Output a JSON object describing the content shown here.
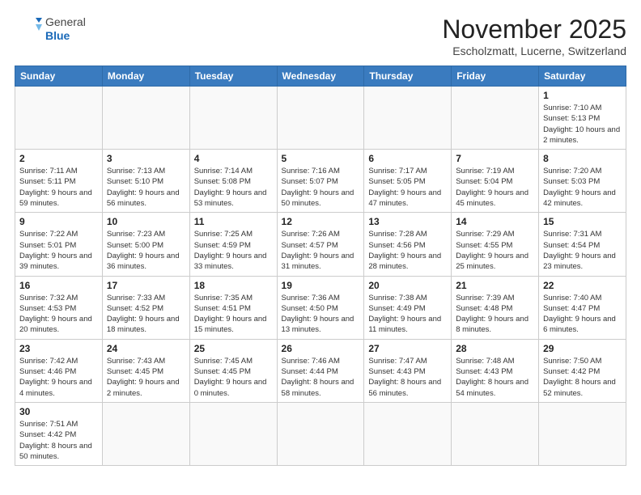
{
  "header": {
    "logo_general": "General",
    "logo_blue": "Blue",
    "month_title": "November 2025",
    "location": "Escholzmatt, Lucerne, Switzerland"
  },
  "weekdays": [
    "Sunday",
    "Monday",
    "Tuesday",
    "Wednesday",
    "Thursday",
    "Friday",
    "Saturday"
  ],
  "weeks": [
    [
      {
        "day": "",
        "info": ""
      },
      {
        "day": "",
        "info": ""
      },
      {
        "day": "",
        "info": ""
      },
      {
        "day": "",
        "info": ""
      },
      {
        "day": "",
        "info": ""
      },
      {
        "day": "",
        "info": ""
      },
      {
        "day": "1",
        "info": "Sunrise: 7:10 AM\nSunset: 5:13 PM\nDaylight: 10 hours\nand 2 minutes."
      }
    ],
    [
      {
        "day": "2",
        "info": "Sunrise: 7:11 AM\nSunset: 5:11 PM\nDaylight: 9 hours\nand 59 minutes."
      },
      {
        "day": "3",
        "info": "Sunrise: 7:13 AM\nSunset: 5:10 PM\nDaylight: 9 hours\nand 56 minutes."
      },
      {
        "day": "4",
        "info": "Sunrise: 7:14 AM\nSunset: 5:08 PM\nDaylight: 9 hours\nand 53 minutes."
      },
      {
        "day": "5",
        "info": "Sunrise: 7:16 AM\nSunset: 5:07 PM\nDaylight: 9 hours\nand 50 minutes."
      },
      {
        "day": "6",
        "info": "Sunrise: 7:17 AM\nSunset: 5:05 PM\nDaylight: 9 hours\nand 47 minutes."
      },
      {
        "day": "7",
        "info": "Sunrise: 7:19 AM\nSunset: 5:04 PM\nDaylight: 9 hours\nand 45 minutes."
      },
      {
        "day": "8",
        "info": "Sunrise: 7:20 AM\nSunset: 5:03 PM\nDaylight: 9 hours\nand 42 minutes."
      }
    ],
    [
      {
        "day": "9",
        "info": "Sunrise: 7:22 AM\nSunset: 5:01 PM\nDaylight: 9 hours\nand 39 minutes."
      },
      {
        "day": "10",
        "info": "Sunrise: 7:23 AM\nSunset: 5:00 PM\nDaylight: 9 hours\nand 36 minutes."
      },
      {
        "day": "11",
        "info": "Sunrise: 7:25 AM\nSunset: 4:59 PM\nDaylight: 9 hours\nand 33 minutes."
      },
      {
        "day": "12",
        "info": "Sunrise: 7:26 AM\nSunset: 4:57 PM\nDaylight: 9 hours\nand 31 minutes."
      },
      {
        "day": "13",
        "info": "Sunrise: 7:28 AM\nSunset: 4:56 PM\nDaylight: 9 hours\nand 28 minutes."
      },
      {
        "day": "14",
        "info": "Sunrise: 7:29 AM\nSunset: 4:55 PM\nDaylight: 9 hours\nand 25 minutes."
      },
      {
        "day": "15",
        "info": "Sunrise: 7:31 AM\nSunset: 4:54 PM\nDaylight: 9 hours\nand 23 minutes."
      }
    ],
    [
      {
        "day": "16",
        "info": "Sunrise: 7:32 AM\nSunset: 4:53 PM\nDaylight: 9 hours\nand 20 minutes."
      },
      {
        "day": "17",
        "info": "Sunrise: 7:33 AM\nSunset: 4:52 PM\nDaylight: 9 hours\nand 18 minutes."
      },
      {
        "day": "18",
        "info": "Sunrise: 7:35 AM\nSunset: 4:51 PM\nDaylight: 9 hours\nand 15 minutes."
      },
      {
        "day": "19",
        "info": "Sunrise: 7:36 AM\nSunset: 4:50 PM\nDaylight: 9 hours\nand 13 minutes."
      },
      {
        "day": "20",
        "info": "Sunrise: 7:38 AM\nSunset: 4:49 PM\nDaylight: 9 hours\nand 11 minutes."
      },
      {
        "day": "21",
        "info": "Sunrise: 7:39 AM\nSunset: 4:48 PM\nDaylight: 9 hours\nand 8 minutes."
      },
      {
        "day": "22",
        "info": "Sunrise: 7:40 AM\nSunset: 4:47 PM\nDaylight: 9 hours\nand 6 minutes."
      }
    ],
    [
      {
        "day": "23",
        "info": "Sunrise: 7:42 AM\nSunset: 4:46 PM\nDaylight: 9 hours\nand 4 minutes."
      },
      {
        "day": "24",
        "info": "Sunrise: 7:43 AM\nSunset: 4:45 PM\nDaylight: 9 hours\nand 2 minutes."
      },
      {
        "day": "25",
        "info": "Sunrise: 7:45 AM\nSunset: 4:45 PM\nDaylight: 9 hours\nand 0 minutes."
      },
      {
        "day": "26",
        "info": "Sunrise: 7:46 AM\nSunset: 4:44 PM\nDaylight: 8 hours\nand 58 minutes."
      },
      {
        "day": "27",
        "info": "Sunrise: 7:47 AM\nSunset: 4:43 PM\nDaylight: 8 hours\nand 56 minutes."
      },
      {
        "day": "28",
        "info": "Sunrise: 7:48 AM\nSunset: 4:43 PM\nDaylight: 8 hours\nand 54 minutes."
      },
      {
        "day": "29",
        "info": "Sunrise: 7:50 AM\nSunset: 4:42 PM\nDaylight: 8 hours\nand 52 minutes."
      }
    ],
    [
      {
        "day": "30",
        "info": "Sunrise: 7:51 AM\nSunset: 4:42 PM\nDaylight: 8 hours\nand 50 minutes."
      },
      {
        "day": "",
        "info": ""
      },
      {
        "day": "",
        "info": ""
      },
      {
        "day": "",
        "info": ""
      },
      {
        "day": "",
        "info": ""
      },
      {
        "day": "",
        "info": ""
      },
      {
        "day": "",
        "info": ""
      }
    ]
  ]
}
